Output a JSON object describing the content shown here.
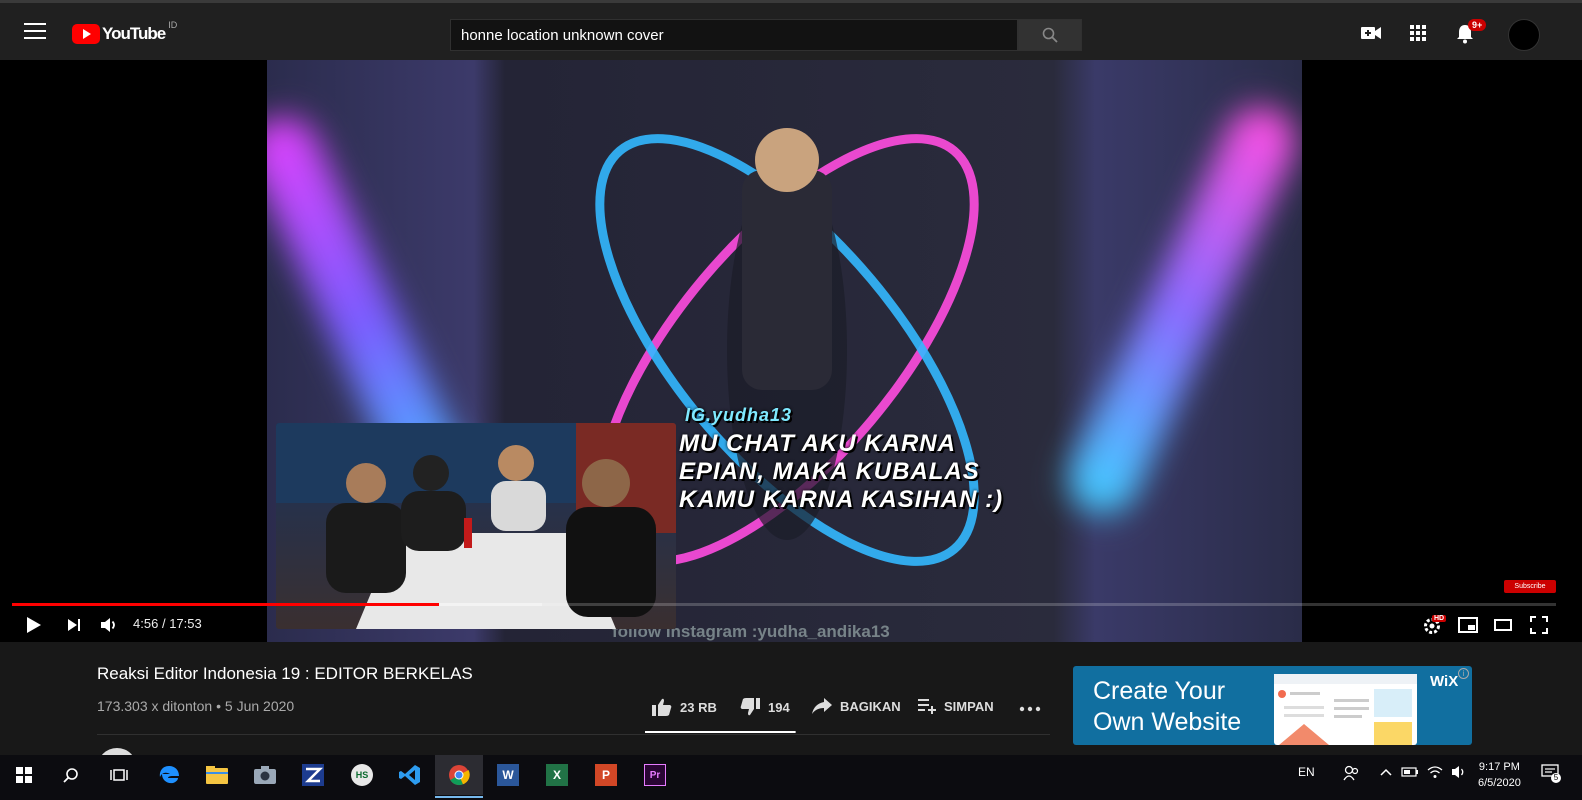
{
  "header": {
    "logo_text": "YouTube",
    "region": "ID",
    "search_value": "honne location unknown cover",
    "notification_count": "9+"
  },
  "video": {
    "overlay_lines": [
      "MU CHAT AKU KARNA",
      "EPIAN, MAKA KUBALAS",
      "KAMU KARNA KASIHAN :)"
    ],
    "overlay_handle": "IG.yudha13",
    "follow_text": "follow Instagram :yudha_andika13",
    "subscribe_badge": "Subscribe",
    "progress_played": 0.2768,
    "progress_buffered": 0.343
  },
  "controls": {
    "time_current": "4:56",
    "time_separator": "/",
    "time_total": "17:53",
    "settings_badge": "HD"
  },
  "info": {
    "title": "Reaksi Editor Indonesia 19 : EDITOR BERKELAS",
    "views": "173.303 x ditonton",
    "dot": "•",
    "date": "5 Jun 2020",
    "likes": "23 RB",
    "dislikes": "194",
    "share_label": "BAGIKAN",
    "save_label": "SIMPAN",
    "like_ratio": 0.992
  },
  "ad": {
    "line1": "Create Your",
    "line2": "Own Website",
    "brand": "WiX",
    "info": "i",
    "color": "#116fa0"
  },
  "taskbar": {
    "apps": [
      "start-icon",
      "search-icon",
      "task-view-icon",
      "edge-icon",
      "file-explorer-icon",
      "camera-icon",
      "app-z-icon",
      "hs-icon",
      "vscode-icon",
      "chrome-icon",
      "word-icon",
      "excel-icon",
      "powerpoint-icon",
      "premiere-icon"
    ],
    "hs_label": "HS",
    "word_label": "W",
    "excel_label": "X",
    "ppt_label": "P",
    "premiere_label": "Pr",
    "language": "EN",
    "time": "9:17 PM",
    "date": "6/5/2020",
    "notification_count": "5"
  },
  "colors": {
    "accent_red": "#ff0000",
    "background": "#181818",
    "header": "#202020"
  }
}
